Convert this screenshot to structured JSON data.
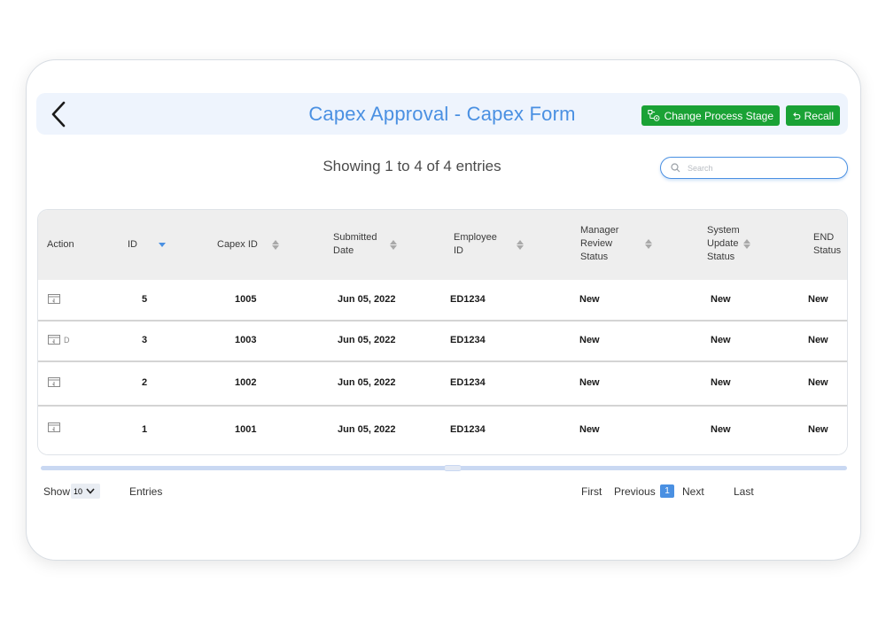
{
  "header": {
    "title": "Capex Approval - Capex Form",
    "change_stage_label": "Change Process Stage",
    "recall_label": "Recall"
  },
  "summary": {
    "text": "Showing 1 to 4 of 4 entries"
  },
  "search": {
    "placeholder": "Search"
  },
  "table": {
    "columns": {
      "action": "Action",
      "id": "ID",
      "capex_id": "Capex ID",
      "submitted_date": [
        "Submitted",
        "Date"
      ],
      "employee_id": [
        "Employee",
        "ID"
      ],
      "manager_review_status": [
        "Manager",
        "Review",
        "Status"
      ],
      "system_update_status": [
        "System",
        "Update",
        "Status"
      ],
      "end_status": [
        "END",
        "Status"
      ]
    },
    "rows": [
      {
        "action_extra": "",
        "id": "5",
        "capex_id": "1005",
        "submitted_date": "Jun 05, 2022",
        "employee_id": "ED1234",
        "manager_review_status": "New",
        "system_update_status": "New",
        "end_status": "New"
      },
      {
        "action_extra": "D",
        "id": "3",
        "capex_id": "1003",
        "submitted_date": "Jun 05, 2022",
        "employee_id": "ED1234",
        "manager_review_status": "New",
        "system_update_status": "New",
        "end_status": "New"
      },
      {
        "action_extra": "",
        "id": "2",
        "capex_id": "1002",
        "submitted_date": "Jun 05, 2022",
        "employee_id": "ED1234",
        "manager_review_status": "New",
        "system_update_status": "New",
        "end_status": "New"
      },
      {
        "action_extra": "",
        "id": "1",
        "capex_id": "1001",
        "submitted_date": "Jun 05, 2022",
        "employee_id": "ED1234",
        "manager_review_status": "New",
        "system_update_status": "New",
        "end_status": "New"
      }
    ]
  },
  "footer": {
    "show_label": "Show",
    "page_size": "10",
    "entries_label": "Entries",
    "first_label": "First",
    "previous_label": "Previous",
    "current_page": "1",
    "next_label": "Next",
    "last_label": "Last"
  },
  "colors": {
    "accent": "#4a90e2",
    "action_green": "#1aa235"
  },
  "icons": {
    "back": "chevron-left-icon",
    "stage": "process-stage-icon",
    "recall": "undo-icon",
    "search": "search-icon",
    "row_action": "open-form-icon",
    "select": "chevron-down-icon"
  }
}
